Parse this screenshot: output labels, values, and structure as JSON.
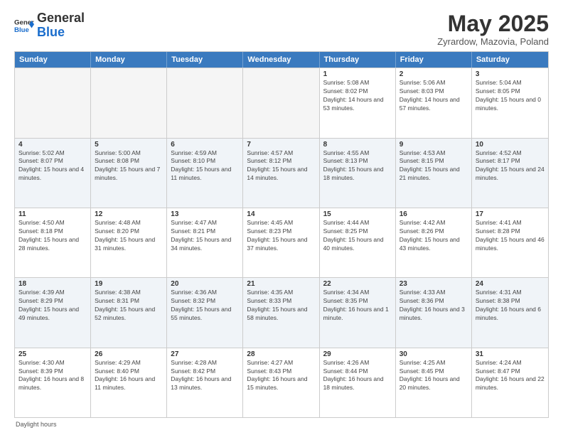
{
  "logo": {
    "general": "General",
    "blue": "Blue"
  },
  "title": "May 2025",
  "subtitle": "Zyrardow, Mazovia, Poland",
  "header_days": [
    "Sunday",
    "Monday",
    "Tuesday",
    "Wednesday",
    "Thursday",
    "Friday",
    "Saturday"
  ],
  "footer": "Daylight hours",
  "weeks": [
    [
      {
        "day": "",
        "sunrise": "",
        "sunset": "",
        "daylight": "",
        "empty": true
      },
      {
        "day": "",
        "sunrise": "",
        "sunset": "",
        "daylight": "",
        "empty": true
      },
      {
        "day": "",
        "sunrise": "",
        "sunset": "",
        "daylight": "",
        "empty": true
      },
      {
        "day": "",
        "sunrise": "",
        "sunset": "",
        "daylight": "",
        "empty": true
      },
      {
        "day": "1",
        "sunrise": "Sunrise: 5:08 AM",
        "sunset": "Sunset: 8:02 PM",
        "daylight": "Daylight: 14 hours and 53 minutes.",
        "empty": false
      },
      {
        "day": "2",
        "sunrise": "Sunrise: 5:06 AM",
        "sunset": "Sunset: 8:03 PM",
        "daylight": "Daylight: 14 hours and 57 minutes.",
        "empty": false
      },
      {
        "day": "3",
        "sunrise": "Sunrise: 5:04 AM",
        "sunset": "Sunset: 8:05 PM",
        "daylight": "Daylight: 15 hours and 0 minutes.",
        "empty": false
      }
    ],
    [
      {
        "day": "4",
        "sunrise": "Sunrise: 5:02 AM",
        "sunset": "Sunset: 8:07 PM",
        "daylight": "Daylight: 15 hours and 4 minutes.",
        "empty": false
      },
      {
        "day": "5",
        "sunrise": "Sunrise: 5:00 AM",
        "sunset": "Sunset: 8:08 PM",
        "daylight": "Daylight: 15 hours and 7 minutes.",
        "empty": false
      },
      {
        "day": "6",
        "sunrise": "Sunrise: 4:59 AM",
        "sunset": "Sunset: 8:10 PM",
        "daylight": "Daylight: 15 hours and 11 minutes.",
        "empty": false
      },
      {
        "day": "7",
        "sunrise": "Sunrise: 4:57 AM",
        "sunset": "Sunset: 8:12 PM",
        "daylight": "Daylight: 15 hours and 14 minutes.",
        "empty": false
      },
      {
        "day": "8",
        "sunrise": "Sunrise: 4:55 AM",
        "sunset": "Sunset: 8:13 PM",
        "daylight": "Daylight: 15 hours and 18 minutes.",
        "empty": false
      },
      {
        "day": "9",
        "sunrise": "Sunrise: 4:53 AM",
        "sunset": "Sunset: 8:15 PM",
        "daylight": "Daylight: 15 hours and 21 minutes.",
        "empty": false
      },
      {
        "day": "10",
        "sunrise": "Sunrise: 4:52 AM",
        "sunset": "Sunset: 8:17 PM",
        "daylight": "Daylight: 15 hours and 24 minutes.",
        "empty": false
      }
    ],
    [
      {
        "day": "11",
        "sunrise": "Sunrise: 4:50 AM",
        "sunset": "Sunset: 8:18 PM",
        "daylight": "Daylight: 15 hours and 28 minutes.",
        "empty": false
      },
      {
        "day": "12",
        "sunrise": "Sunrise: 4:48 AM",
        "sunset": "Sunset: 8:20 PM",
        "daylight": "Daylight: 15 hours and 31 minutes.",
        "empty": false
      },
      {
        "day": "13",
        "sunrise": "Sunrise: 4:47 AM",
        "sunset": "Sunset: 8:21 PM",
        "daylight": "Daylight: 15 hours and 34 minutes.",
        "empty": false
      },
      {
        "day": "14",
        "sunrise": "Sunrise: 4:45 AM",
        "sunset": "Sunset: 8:23 PM",
        "daylight": "Daylight: 15 hours and 37 minutes.",
        "empty": false
      },
      {
        "day": "15",
        "sunrise": "Sunrise: 4:44 AM",
        "sunset": "Sunset: 8:25 PM",
        "daylight": "Daylight: 15 hours and 40 minutes.",
        "empty": false
      },
      {
        "day": "16",
        "sunrise": "Sunrise: 4:42 AM",
        "sunset": "Sunset: 8:26 PM",
        "daylight": "Daylight: 15 hours and 43 minutes.",
        "empty": false
      },
      {
        "day": "17",
        "sunrise": "Sunrise: 4:41 AM",
        "sunset": "Sunset: 8:28 PM",
        "daylight": "Daylight: 15 hours and 46 minutes.",
        "empty": false
      }
    ],
    [
      {
        "day": "18",
        "sunrise": "Sunrise: 4:39 AM",
        "sunset": "Sunset: 8:29 PM",
        "daylight": "Daylight: 15 hours and 49 minutes.",
        "empty": false
      },
      {
        "day": "19",
        "sunrise": "Sunrise: 4:38 AM",
        "sunset": "Sunset: 8:31 PM",
        "daylight": "Daylight: 15 hours and 52 minutes.",
        "empty": false
      },
      {
        "day": "20",
        "sunrise": "Sunrise: 4:36 AM",
        "sunset": "Sunset: 8:32 PM",
        "daylight": "Daylight: 15 hours and 55 minutes.",
        "empty": false
      },
      {
        "day": "21",
        "sunrise": "Sunrise: 4:35 AM",
        "sunset": "Sunset: 8:33 PM",
        "daylight": "Daylight: 15 hours and 58 minutes.",
        "empty": false
      },
      {
        "day": "22",
        "sunrise": "Sunrise: 4:34 AM",
        "sunset": "Sunset: 8:35 PM",
        "daylight": "Daylight: 16 hours and 1 minute.",
        "empty": false
      },
      {
        "day": "23",
        "sunrise": "Sunrise: 4:33 AM",
        "sunset": "Sunset: 8:36 PM",
        "daylight": "Daylight: 16 hours and 3 minutes.",
        "empty": false
      },
      {
        "day": "24",
        "sunrise": "Sunrise: 4:31 AM",
        "sunset": "Sunset: 8:38 PM",
        "daylight": "Daylight: 16 hours and 6 minutes.",
        "empty": false
      }
    ],
    [
      {
        "day": "25",
        "sunrise": "Sunrise: 4:30 AM",
        "sunset": "Sunset: 8:39 PM",
        "daylight": "Daylight: 16 hours and 8 minutes.",
        "empty": false
      },
      {
        "day": "26",
        "sunrise": "Sunrise: 4:29 AM",
        "sunset": "Sunset: 8:40 PM",
        "daylight": "Daylight: 16 hours and 11 minutes.",
        "empty": false
      },
      {
        "day": "27",
        "sunrise": "Sunrise: 4:28 AM",
        "sunset": "Sunset: 8:42 PM",
        "daylight": "Daylight: 16 hours and 13 minutes.",
        "empty": false
      },
      {
        "day": "28",
        "sunrise": "Sunrise: 4:27 AM",
        "sunset": "Sunset: 8:43 PM",
        "daylight": "Daylight: 16 hours and 15 minutes.",
        "empty": false
      },
      {
        "day": "29",
        "sunrise": "Sunrise: 4:26 AM",
        "sunset": "Sunset: 8:44 PM",
        "daylight": "Daylight: 16 hours and 18 minutes.",
        "empty": false
      },
      {
        "day": "30",
        "sunrise": "Sunrise: 4:25 AM",
        "sunset": "Sunset: 8:45 PM",
        "daylight": "Daylight: 16 hours and 20 minutes.",
        "empty": false
      },
      {
        "day": "31",
        "sunrise": "Sunrise: 4:24 AM",
        "sunset": "Sunset: 8:47 PM",
        "daylight": "Daylight: 16 hours and 22 minutes.",
        "empty": false
      }
    ]
  ]
}
